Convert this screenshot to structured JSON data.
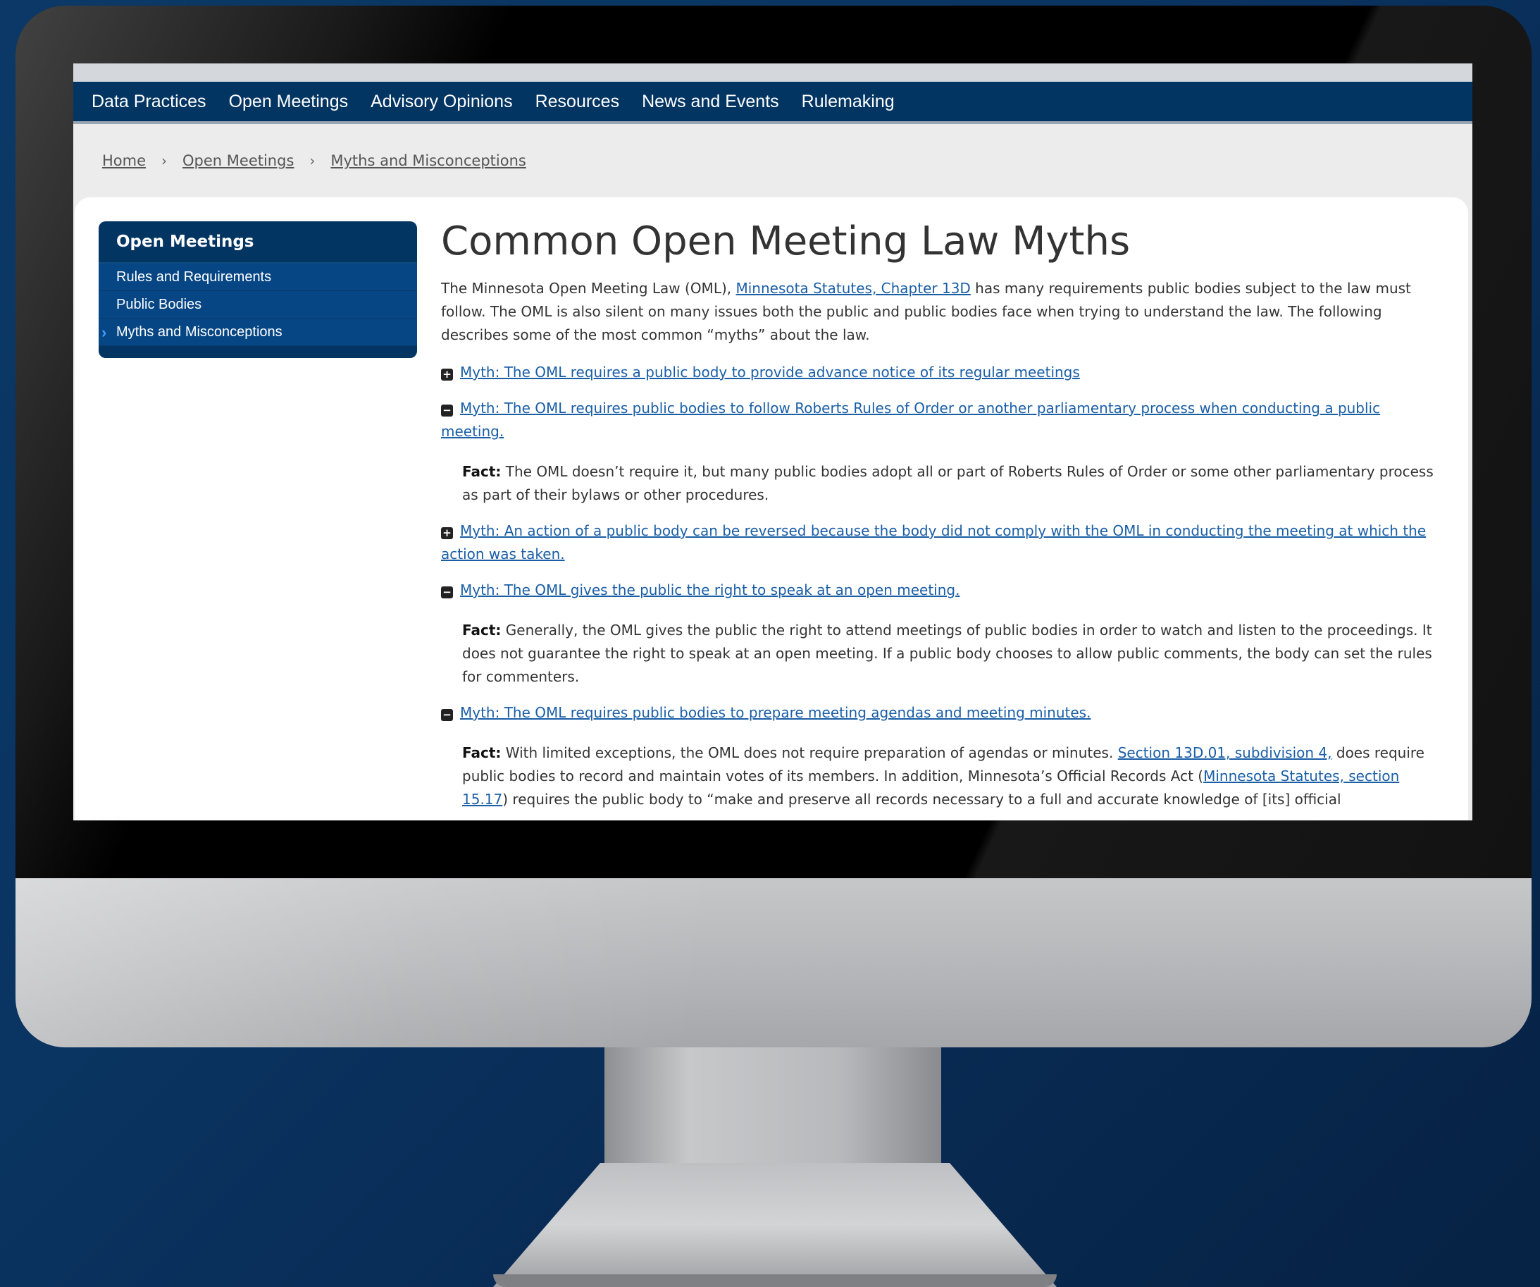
{
  "nav": {
    "items": [
      "Data Practices",
      "Open Meetings",
      "Advisory Opinions",
      "Resources",
      "News and Events",
      "Rulemaking"
    ]
  },
  "breadcrumb": {
    "home": "Home",
    "section": "Open Meetings",
    "current": "Myths and Misconceptions",
    "separator": "›"
  },
  "sidebar": {
    "title": "Open Meetings",
    "items": [
      "Rules and Requirements",
      "Public Bodies",
      "Myths and Misconceptions"
    ],
    "active_index": 2
  },
  "main": {
    "title": "Common Open Meeting Law Myths",
    "intro": {
      "before_link": "The Minnesota Open Meeting Law (OML), ",
      "link": "Minnesota Statutes, Chapter 13D",
      "after_link": " has many requirements public bodies subject to the law must follow. The OML is also silent on many issues both the public and public bodies face when trying to understand the law. The following describes some of the most common “myths” about the law."
    },
    "myths": [
      {
        "toggle": "+",
        "text": "Myth: The OML requires a public body to provide advance notice of its regular meetings"
      },
      {
        "toggle": "−",
        "text": "Myth: The OML requires public bodies to follow Roberts Rules of Order or another parliamentary process when conducting a public meeting."
      },
      {
        "toggle": "+",
        "text": "Myth: An action of a public body can be reversed because the body did not comply with the OML in conducting the meeting at which the action was taken."
      },
      {
        "toggle": "−",
        "text": "Myth: The OML gives the public the right to speak at an open meeting."
      },
      {
        "toggle": "−",
        "text": "Myth: The OML requires public bodies to prepare meeting agendas and meeting minutes."
      }
    ],
    "facts": {
      "label": "Fact:",
      "roberts": " The OML doesn’t require it, but many public bodies adopt all or part of Roberts Rules of Order or some other parliamentary process as part of their bylaws or other procedures.",
      "speak": " Generally, the OML gives the public the right to attend meetings of public bodies in order to watch and listen to the proceedings. It does not guarantee the right to speak at an open meeting. If a public body chooses to allow public comments, the body can set the rules for commenters.",
      "agenda_1": " With limited exceptions, the OML does not require preparation of agendas or minutes. ",
      "agenda_link1": "Section 13D.01, subdivision 4,",
      "agenda_2": " does require public bodies to record and maintain votes of its members. In addition, Minnesota’s Official Records Act (",
      "agenda_link2": "Minnesota Statutes, section 15.17",
      "agenda_3": ") requires the public body to “make and preserve all records necessary to a full and accurate knowledge of [its] official"
    }
  },
  "colors": {
    "nav_bg": "#033563",
    "link": "#1a5ea6",
    "sidebar_item_bg": "#064684",
    "page_bg": "#0a3461"
  },
  "icons": {
    "expand": "plus-square-icon",
    "collapse": "minus-square-icon",
    "active_marker": "chevron-right-icon"
  }
}
